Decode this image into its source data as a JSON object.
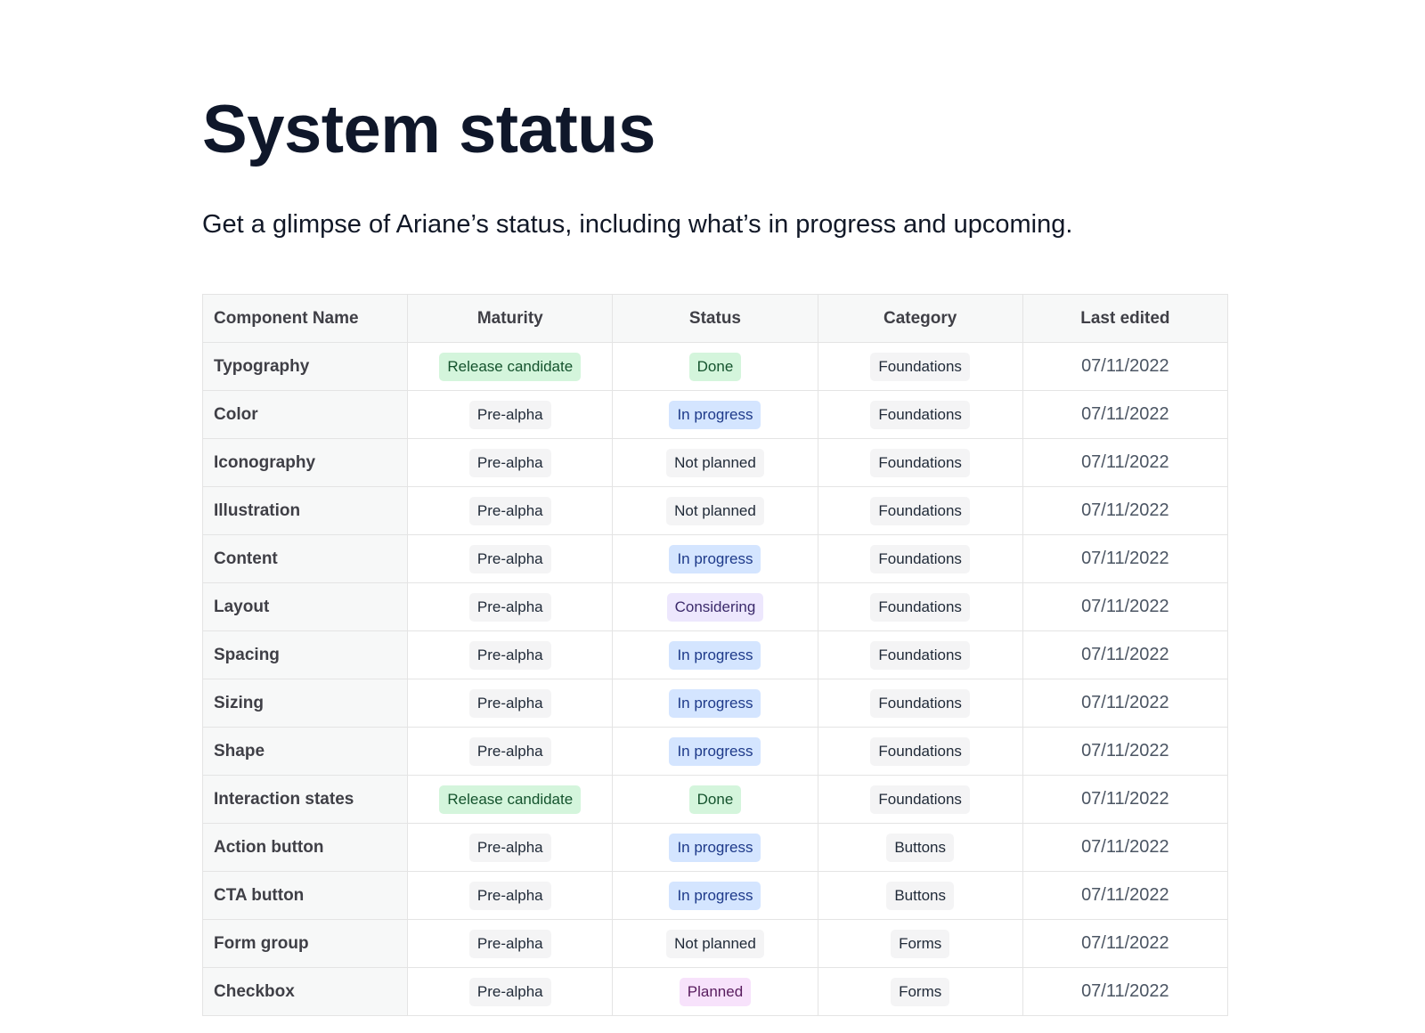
{
  "page": {
    "title": "System status",
    "subtitle": "Get a glimpse of Ariane’s status, including what’s in progress and upcoming."
  },
  "table": {
    "headers": [
      "Component Name",
      "Maturity",
      "Status",
      "Category",
      "Last edited"
    ],
    "tones": {
      "Release candidate": "green",
      "Pre-alpha": "gray",
      "Done": "green",
      "In progress": "blue",
      "Not planned": "gray",
      "Considering": "lavender",
      "Planned": "pink",
      "Foundations": "gray",
      "Buttons": "gray",
      "Forms": "gray"
    },
    "tone_colors": {
      "green": "#d4f5dc",
      "blue": "#d4e5ff",
      "lavender": "#ede7fd",
      "pink": "#f7e2fb",
      "gray": "#f4f4f5"
    },
    "rows": [
      {
        "name": "Typography",
        "maturity": "Release candidate",
        "status": "Done",
        "category": "Foundations",
        "last_edited": "07/11/2022"
      },
      {
        "name": "Color",
        "maturity": "Pre-alpha",
        "status": "In progress",
        "category": "Foundations",
        "last_edited": "07/11/2022"
      },
      {
        "name": "Iconography",
        "maturity": "Pre-alpha",
        "status": "Not planned",
        "category": "Foundations",
        "last_edited": "07/11/2022"
      },
      {
        "name": "Illustration",
        "maturity": "Pre-alpha",
        "status": "Not planned",
        "category": "Foundations",
        "last_edited": "07/11/2022"
      },
      {
        "name": "Content",
        "maturity": "Pre-alpha",
        "status": "In progress",
        "category": "Foundations",
        "last_edited": "07/11/2022"
      },
      {
        "name": "Layout",
        "maturity": "Pre-alpha",
        "status": "Considering",
        "category": "Foundations",
        "last_edited": "07/11/2022"
      },
      {
        "name": "Spacing",
        "maturity": "Pre-alpha",
        "status": "In progress",
        "category": "Foundations",
        "last_edited": "07/11/2022"
      },
      {
        "name": "Sizing",
        "maturity": "Pre-alpha",
        "status": "In progress",
        "category": "Foundations",
        "last_edited": "07/11/2022"
      },
      {
        "name": "Shape",
        "maturity": "Pre-alpha",
        "status": "In progress",
        "category": "Foundations",
        "last_edited": "07/11/2022"
      },
      {
        "name": "Interaction states",
        "maturity": "Release candidate",
        "status": "Done",
        "category": "Foundations",
        "last_edited": "07/11/2022"
      },
      {
        "name": "Action button",
        "maturity": "Pre-alpha",
        "status": "In progress",
        "category": "Buttons",
        "last_edited": "07/11/2022"
      },
      {
        "name": "CTA button",
        "maturity": "Pre-alpha",
        "status": "In progress",
        "category": "Buttons",
        "last_edited": "07/11/2022"
      },
      {
        "name": "Form group",
        "maturity": "Pre-alpha",
        "status": "Not planned",
        "category": "Forms",
        "last_edited": "07/11/2022"
      },
      {
        "name": "Checkbox",
        "maturity": "Pre-alpha",
        "status": "Planned",
        "category": "Forms",
        "last_edited": "07/11/2022"
      }
    ]
  }
}
